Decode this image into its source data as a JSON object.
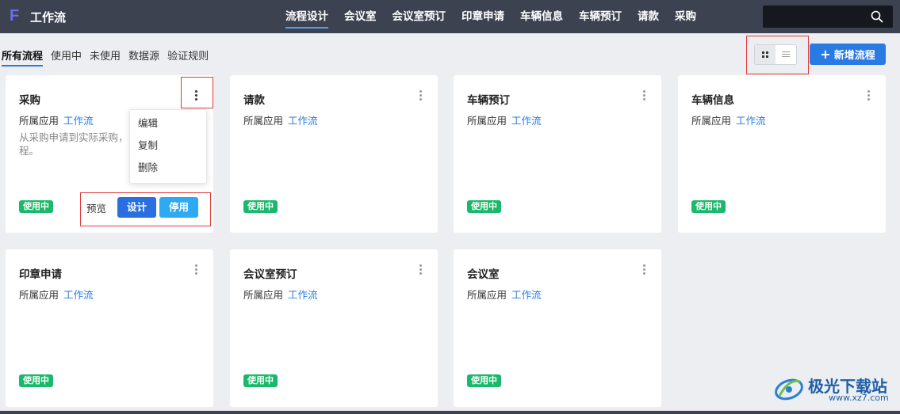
{
  "app": {
    "logo_letter": "F",
    "title": "工作流"
  },
  "nav": {
    "items": [
      {
        "label": "流程设计",
        "active": true
      },
      {
        "label": "会议室"
      },
      {
        "label": "会议室预订"
      },
      {
        "label": "印章申请"
      },
      {
        "label": "车辆信息"
      },
      {
        "label": "车辆预订"
      },
      {
        "label": "请款"
      },
      {
        "label": "采购"
      }
    ],
    "search": {
      "value": "",
      "placeholder": "",
      "icon": "search-icon"
    }
  },
  "filters": [
    "所有流程",
    "使用中",
    "未使用",
    "数据源",
    "验证规则"
  ],
  "view_toggle": {
    "selected": "grid",
    "icons": [
      "grid-icon",
      "list-icon"
    ]
  },
  "add_button": {
    "icon": "plus-icon",
    "label": "新增流程"
  },
  "app_label": "所属应用",
  "cards": [
    {
      "title": "采购",
      "app": "工作流",
      "desc": "从采购申请到实际采购，",
      "desc2": "程。",
      "status": "使用中"
    },
    {
      "title": "请款",
      "app": "工作流",
      "status": "使用中"
    },
    {
      "title": "车辆预订",
      "app": "工作流",
      "status": "使用中"
    },
    {
      "title": "车辆信息",
      "app": "工作流",
      "status": "使用中"
    },
    {
      "title": "印章申请",
      "app": "工作流",
      "status": "使用中"
    },
    {
      "title": "会议室预订",
      "app": "工作流",
      "status": "使用中"
    },
    {
      "title": "会议室",
      "app": "工作流",
      "status": "使用中"
    }
  ],
  "card_actions": {
    "preview": "预览",
    "design": "设计",
    "disable": "停用"
  },
  "context_menu": [
    "编辑",
    "复制",
    "删除"
  ],
  "watermark": {
    "text": "极光下载站",
    "url": "www.xz7.com"
  },
  "colors": {
    "topbar": "#3c4250",
    "accent": "#2a7ae4",
    "status_green": "#19b86a",
    "highlight_box": "#e23b3b"
  }
}
